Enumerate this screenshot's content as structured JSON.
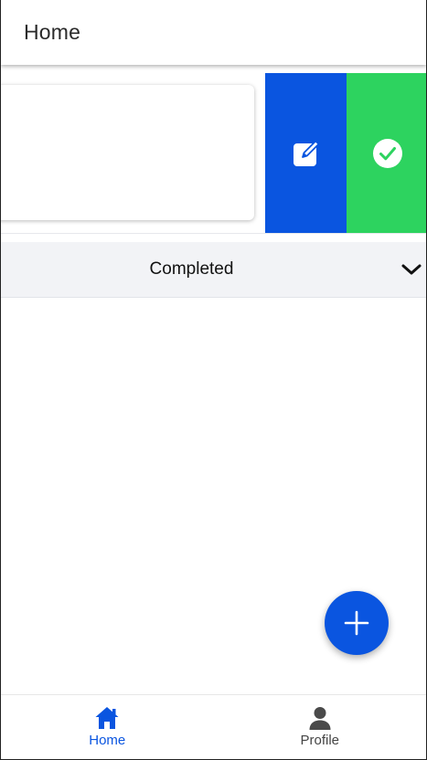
{
  "header": {
    "title": "Home"
  },
  "swipe_actions": {
    "edit_icon": "edit-icon",
    "complete_icon": "check-circle-icon",
    "edit_color": "#0a55e0",
    "complete_color": "#2dd35f"
  },
  "section": {
    "label": "Completed",
    "chevron_icon": "chevron-down-icon"
  },
  "fab": {
    "icon": "plus-icon",
    "color": "#0a55e0"
  },
  "bottom_nav": {
    "items": [
      {
        "label": "Home",
        "icon": "home-icon",
        "active": true
      },
      {
        "label": "Profile",
        "icon": "person-icon",
        "active": false
      }
    ]
  },
  "colors": {
    "accent": "#0a55e0",
    "success": "#2dd35f",
    "section_bg": "#f2f3f6"
  }
}
